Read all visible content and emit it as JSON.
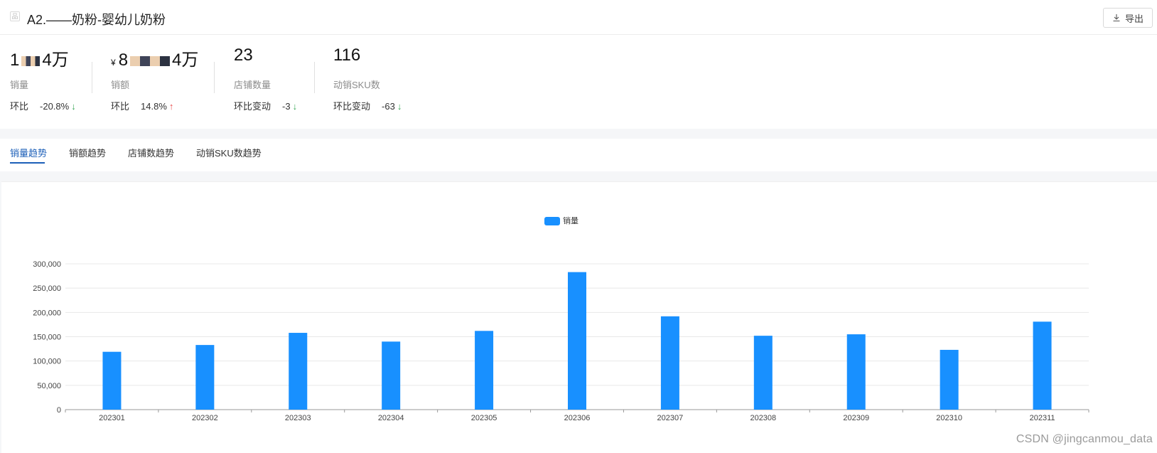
{
  "header": {
    "title": "A2.——奶粉-婴幼儿奶粉",
    "export_label": "导出"
  },
  "kpis": [
    {
      "value_prefix": "1",
      "value_suffix": "4万",
      "label": "销量",
      "change_label": "环比",
      "change_value": "-20.8%",
      "direction": "down"
    },
    {
      "currency": "¥",
      "value_prefix": "8",
      "value_suffix": "4万",
      "label": "销额",
      "change_label": "环比",
      "change_value": "14.8%",
      "direction": "up"
    },
    {
      "value": "23",
      "label": "店铺数量",
      "change_label": "环比变动",
      "change_value": "-3",
      "direction": "down"
    },
    {
      "value": "116",
      "label": "动销SKU数",
      "change_label": "环比变动",
      "change_value": "-63",
      "direction": "down"
    }
  ],
  "tabs": [
    {
      "label": "销量趋势",
      "active": true
    },
    {
      "label": "销额趋势",
      "active": false
    },
    {
      "label": "店铺数趋势",
      "active": false
    },
    {
      "label": "动销SKU数趋势",
      "active": false
    }
  ],
  "chart_data": {
    "type": "bar",
    "title": "",
    "xlabel": "",
    "ylabel": "",
    "categories": [
      "202301",
      "202302",
      "202303",
      "202304",
      "202305",
      "202306",
      "202307",
      "202308",
      "202309",
      "202310",
      "202311"
    ],
    "series": [
      {
        "name": "销量",
        "values": [
          119000,
          133000,
          158000,
          140000,
          162000,
          283000,
          192000,
          152000,
          155000,
          123000,
          181000
        ]
      }
    ],
    "ylim": [
      0,
      300000
    ],
    "yticks": [
      0,
      50000,
      100000,
      150000,
      200000,
      250000,
      300000
    ],
    "ytick_labels": [
      "0",
      "50,000",
      "100,000",
      "150,000",
      "200,000",
      "250,000",
      "300,000"
    ],
    "legend_position": "top-center",
    "grid": true,
    "bar_color": "#1890ff"
  },
  "watermark": "CSDN @jingcanmou_data"
}
